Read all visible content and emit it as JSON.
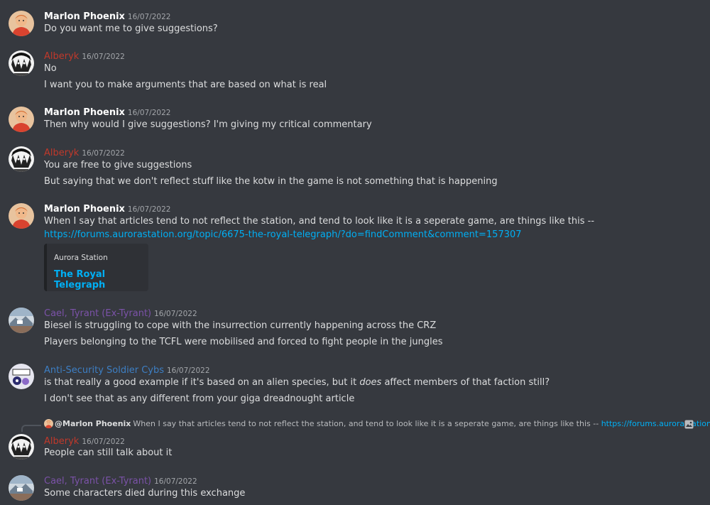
{
  "colors": {
    "marlon": "#ffffff",
    "alberyk": "#c0392b",
    "cael": "#7b52a8",
    "anti": "#3d7fc4",
    "link": "#00aff4"
  },
  "messages": [
    {
      "author": "Marlon Phoenix",
      "timestamp": "16/07/2022",
      "lines": [
        "Do you want me to give suggestions?"
      ]
    },
    {
      "author": "Alberyk",
      "timestamp": "16/07/2022",
      "lines": [
        "No",
        "I want you to make arguments that are based on what is real"
      ]
    },
    {
      "author": "Marlon Phoenix",
      "timestamp": "16/07/2022",
      "lines": [
        "Then why would I give suggestions? I'm giving my critical commentary"
      ]
    },
    {
      "author": "Alberyk",
      "timestamp": "16/07/2022",
      "lines": [
        "You are free to give suggestions",
        "But saying that we don't reflect stuff like the kotw in the game is not something that is happening"
      ]
    },
    {
      "author": "Marlon Phoenix",
      "timestamp": "16/07/2022",
      "lines": [
        "When I say that articles tend to not reflect the station, and tend to look like it is a seperate game, are things like this --"
      ],
      "link": "https://forums.aurorastation.org/topic/6675-the-royal-telegraph/?do=findComment&comment=157307",
      "embed": {
        "provider": "Aurora Station",
        "title": "The Royal Telegraph"
      }
    },
    {
      "author": "Cael, Tyrant (Ex-Tyrant)",
      "timestamp": "16/07/2022",
      "lines": [
        "Biesel is struggling to cope with the insurrection currently happening across the CRZ",
        "Players belonging to the TCFL were mobilised and forced to fight people in the jungles"
      ]
    },
    {
      "author": "Anti-Security Soldier Cybs",
      "timestamp": "16/07/2022",
      "line1_pre": "is that really a good example if it's based on an alien species, but it ",
      "line1_em": "does",
      "line1_post": " affect members of that faction still?",
      "lines": [
        "I don't see that as any different from your giga dreadnought article"
      ]
    },
    {
      "author": "Alberyk",
      "timestamp": "16/07/2022",
      "reply": {
        "mention": "@Marlon Phoenix",
        "text": "When I say that articles tend to not reflect the station, and tend to look like it is a seperate game, are things like this --",
        "link": "https://forums.aurorastation.org/to..."
      },
      "lines": [
        "People can still talk about it"
      ]
    },
    {
      "author": "Cael, Tyrant (Ex-Tyrant)",
      "timestamp": "16/07/2022",
      "lines": [
        "Some characters died during this exchange"
      ]
    }
  ]
}
